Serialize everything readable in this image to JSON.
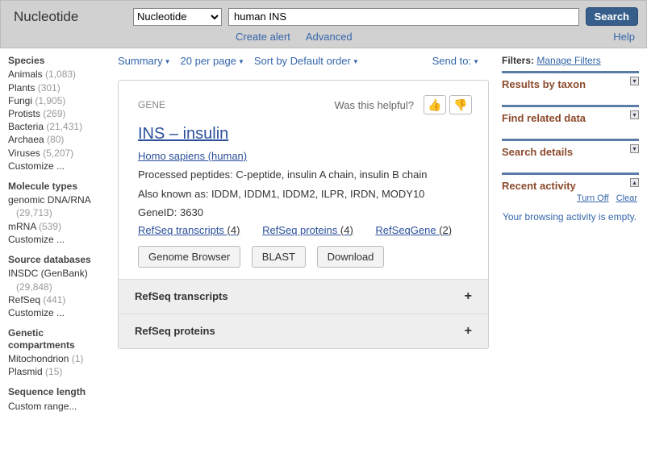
{
  "header": {
    "logo": "Nucleotide",
    "db_selected": "Nucleotide",
    "query": "human INS",
    "search_btn": "Search",
    "create_alert": "Create alert",
    "advanced": "Advanced",
    "help": "Help"
  },
  "toolbar": {
    "summary": "Summary",
    "per_page": "20 per page",
    "sort": "Sort by Default order",
    "send_to": "Send to:"
  },
  "sidebar": {
    "groups": [
      {
        "title": "Species",
        "items": [
          {
            "label": "Animals",
            "count": "(1,083)"
          },
          {
            "label": "Plants",
            "count": "(301)"
          },
          {
            "label": "Fungi",
            "count": "(1,905)"
          },
          {
            "label": "Protists",
            "count": "(269)"
          },
          {
            "label": "Bacteria",
            "count": "(21,431)"
          },
          {
            "label": "Archaea",
            "count": "(80)"
          },
          {
            "label": "Viruses",
            "count": "(5,207)"
          }
        ],
        "customize": "Customize ..."
      },
      {
        "title": "Molecule types",
        "items": [
          {
            "label": "genomic DNA/RNA",
            "count": "(29,713)"
          },
          {
            "label": "mRNA",
            "count": "(539)"
          }
        ],
        "customize": "Customize ..."
      },
      {
        "title": "Source databases",
        "items": [
          {
            "label": "INSDC (GenBank)",
            "count": "(29,848)"
          },
          {
            "label": "RefSeq",
            "count": "(441)"
          }
        ],
        "customize": "Customize ..."
      },
      {
        "title": "Genetic compartments",
        "items": [
          {
            "label": "Mitochondrion",
            "count": "(1)"
          },
          {
            "label": "Plasmid",
            "count": "(15)"
          }
        ]
      },
      {
        "title": "Sequence length",
        "items": [
          {
            "label": "Custom range...",
            "count": ""
          }
        ]
      }
    ]
  },
  "card": {
    "badge": "GENE",
    "helpful": "Was this helpful?",
    "title": "INS  –  insulin",
    "organism": "Homo sapiens (human)",
    "processed": "Processed peptides: C-peptide, insulin A chain, insulin B chain",
    "aka": "Also known as: IDDM, IDDM1, IDDM2, ILPR, IRDN, MODY10",
    "geneid": "GeneID: 3630",
    "links": [
      {
        "label": "RefSeq transcripts ",
        "count": "(4)"
      },
      {
        "label": "RefSeq proteins ",
        "count": "(4)"
      },
      {
        "label": "RefSeqGene ",
        "count": "(2)"
      }
    ],
    "buttons": {
      "genome": "Genome Browser",
      "blast": "BLAST",
      "download": "Download"
    },
    "expanders": [
      "RefSeq transcripts",
      "RefSeq proteins"
    ]
  },
  "right": {
    "filters_label": "Filters:",
    "manage": "Manage Filters",
    "boxes": [
      "Results by taxon",
      "Find related data",
      "Search details",
      "Recent activity"
    ],
    "turn_off": "Turn Off",
    "clear": "Clear",
    "empty": "Your browsing activity is empty."
  }
}
